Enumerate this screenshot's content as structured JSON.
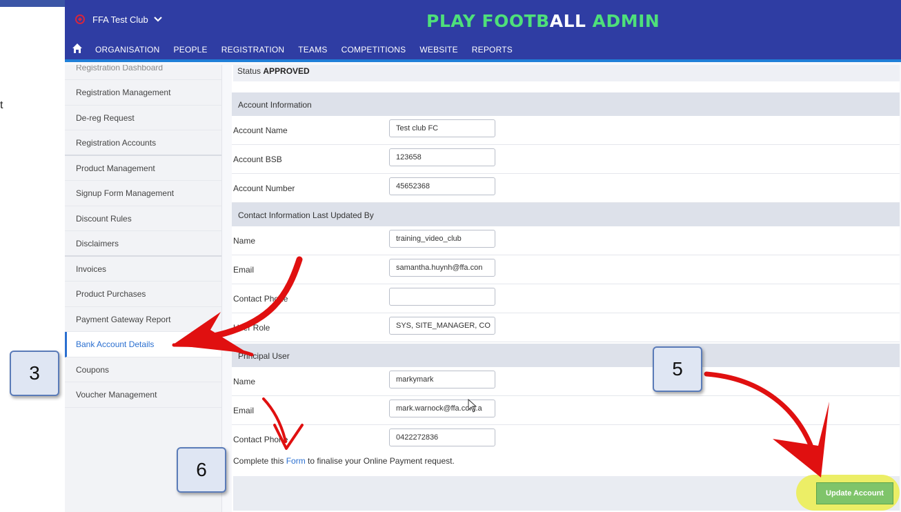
{
  "left_fragment": "t",
  "header": {
    "club_name": "FFA Test Club",
    "brand_part1": "PLAY FOOTB",
    "brand_part2": "ALL",
    "brand_part3": " ADMIN"
  },
  "nav": {
    "items": [
      "ORGANISATION",
      "PEOPLE",
      "REGISTRATION",
      "TEAMS",
      "COMPETITIONS",
      "WEBSITE",
      "REPORTS"
    ]
  },
  "sidebar": {
    "items": [
      "Registration Dashboard",
      "Registration Management",
      "De-reg Request",
      "Registration Accounts",
      "Product Management",
      "Signup Form Management",
      "Discount Rules",
      "Disclaimers",
      "Invoices",
      "Product Purchases",
      "Payment Gateway Report",
      "Bank Account Details",
      "Coupons",
      "Voucher Management"
    ]
  },
  "status": {
    "label": "Status ",
    "value": "APPROVED"
  },
  "account_info": {
    "title": "Account Information",
    "fields": [
      {
        "label": "Account Name",
        "value": "Test club FC"
      },
      {
        "label": "Account BSB",
        "value": "123658"
      },
      {
        "label": "Account Number",
        "value": "45652368"
      }
    ]
  },
  "contact_info": {
    "title": "Contact Information Last Updated By",
    "fields": [
      {
        "label": "Name",
        "value": "training_video_club"
      },
      {
        "label": "Email",
        "value": "samantha.huynh@ffa.con"
      },
      {
        "label": "Contact Phone",
        "value": ""
      },
      {
        "label": "User Role",
        "value": "SYS, SITE_MANAGER, CO"
      }
    ]
  },
  "principal_user": {
    "title": "Principal User",
    "fields": [
      {
        "label": "Name",
        "value": "markymark"
      },
      {
        "label": "Email",
        "value": "mark.warnock@ffa.com.a"
      },
      {
        "label": "Contact Phone",
        "value": "0422272836"
      }
    ]
  },
  "note": {
    "before": "Complete this ",
    "link": "Form",
    "after": " to finalise your Online Payment request."
  },
  "update_button": "Update Account",
  "callouts": {
    "three": "3",
    "five": "5",
    "six": "6"
  },
  "colors": {
    "nav_bg": "#2f3da3",
    "brand_green": "#4ee07a",
    "active_link": "#2a6fd0",
    "button_green": "#7fc46a",
    "highlight_yellow": "#ecee66",
    "annotation_red": "#e01010"
  }
}
